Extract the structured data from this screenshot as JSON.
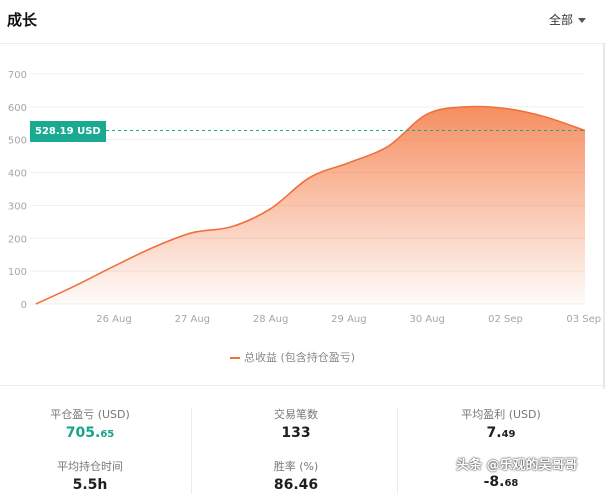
{
  "header": {
    "title": "成长",
    "filter_label": "全部"
  },
  "reference": {
    "label": "528.19 USD",
    "value": 528.19,
    "color": "#1aa991"
  },
  "legend": {
    "label": "总收益 (包含持仓盈亏)",
    "color": "#f0703c"
  },
  "chart_data": {
    "type": "area",
    "ylim": [
      0,
      700
    ],
    "yticks": [
      0,
      100,
      200,
      300,
      400,
      500,
      600,
      700
    ],
    "xticks": [
      "26 Aug",
      "27 Aug",
      "28 Aug",
      "29 Aug",
      "30 Aug",
      "02 Sep",
      "03 Sep"
    ],
    "grid": true,
    "series": [
      {
        "name": "总收益 (包含持仓盈亏)",
        "color": "#f0703c",
        "x": [
          -1.0,
          -0.5,
          0.0,
          0.5,
          1.0,
          1.5,
          2.0,
          2.5,
          3.0,
          3.5,
          4.0,
          4.5,
          5.0,
          5.5,
          6.0
        ],
        "y": [
          0,
          55,
          115,
          172,
          217,
          235,
          290,
          385,
          430,
          480,
          578,
          600,
          595,
          570,
          528
        ]
      }
    ]
  },
  "stats": {
    "realized_pnl": {
      "label": "平仓盈亏 (USD)",
      "int": "705.",
      "frac": "65"
    },
    "trades": {
      "label": "交易笔数",
      "value": "133"
    },
    "avg_profit": {
      "label": "平均盈利 (USD)",
      "int": "7.",
      "frac": "49"
    },
    "avg_hold": {
      "label": "平均持仓时间",
      "value": "5.5h"
    },
    "win_rate": {
      "label": "胜率 (%)",
      "value": "86.46"
    },
    "avg_loss": {
      "int": "-8.",
      "frac": "68"
    }
  },
  "watermark": "头条 @乐观的吴哥哥"
}
